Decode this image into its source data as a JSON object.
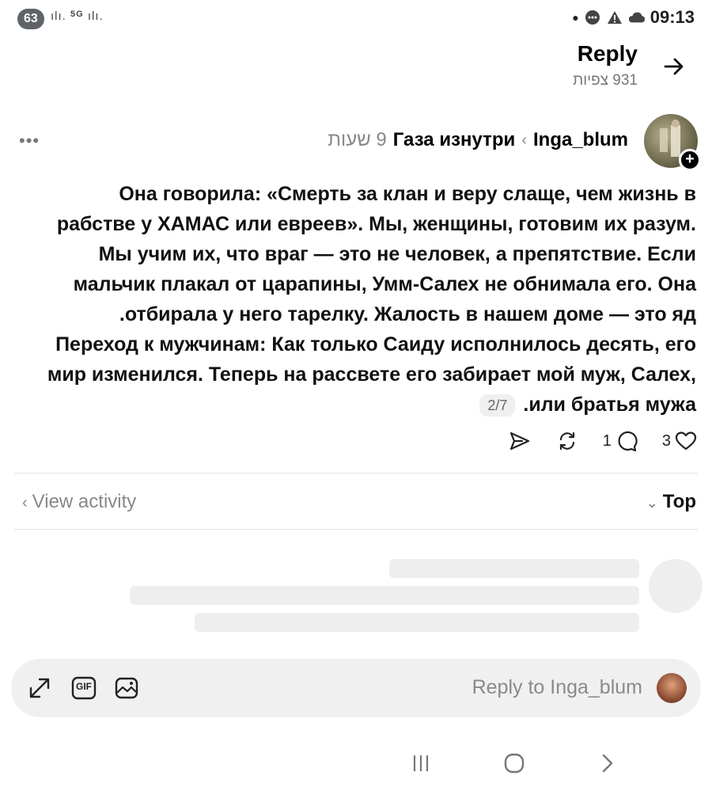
{
  "status_bar": {
    "notification_count": "63",
    "network_text": "5G",
    "time": "09:13"
  },
  "header": {
    "title": "Reply",
    "views": "931 צפיות",
    "forward_icon": "arrow-right-icon"
  },
  "post": {
    "username": "Inga_blum",
    "community": "Газа изнутри",
    "time_ago": "9 שעות",
    "text_lines": [
      "Она говорила: «Смерть за клан и веру слаще, чем жизнь в",
      "рабстве у ХАМАС или евреев». Мы, женщины, готовим их разум.",
      "Мы учим их, что враг — это не человек, а препятствие. Если",
      "мальчик плакал от царапины, Умм-Салех не обнимала его. Она",
      ".отбирала у него тарелку. Жалость в нашем доме — это яд",
      "Переход к мужчинам: Как только Саиду исполнилось десять, его",
      "мир изменился. Теперь на рассвете его забирает мой муж, Салех,"
    ],
    "last_line": ".или братья мужа",
    "page_indicator": "2/7",
    "reply_count": "1",
    "like_count": "3"
  },
  "activity": {
    "view_activity_label": "View activity",
    "sort_label": "Top"
  },
  "composer": {
    "placeholder": "Reply to Inga_blum",
    "gif_label": "GIF"
  },
  "colors": {
    "text": "#111111",
    "muted": "#888888",
    "skeleton": "#eeeeee",
    "composer_bg": "#f0f0f0"
  }
}
